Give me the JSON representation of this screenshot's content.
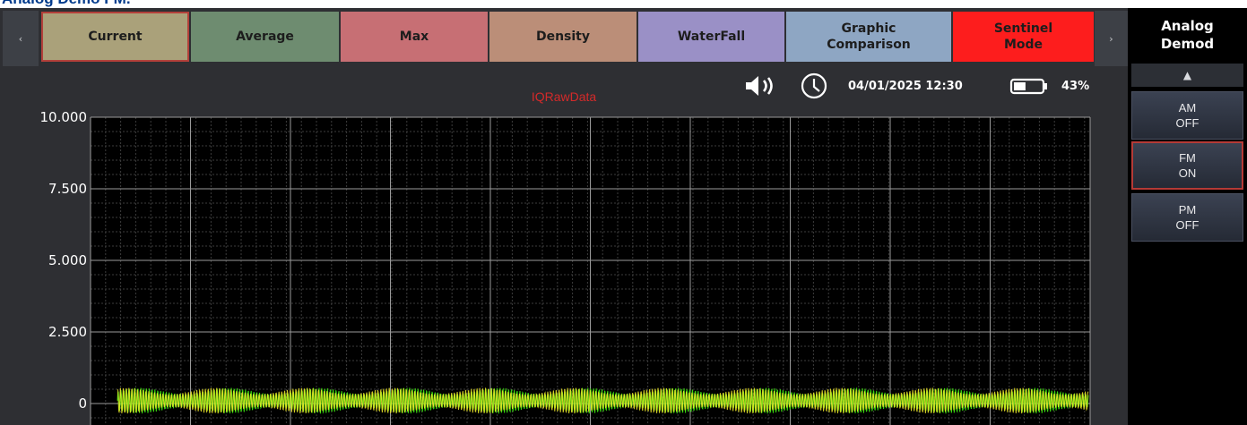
{
  "page_heading": "Analog Demo FM.",
  "tabs": [
    {
      "label": "Current",
      "bg": "#aaa17a",
      "active": true
    },
    {
      "label": "Average",
      "bg": "#6e8c70",
      "active": false
    },
    {
      "label": "Max",
      "bg": "#c76f74",
      "active": false
    },
    {
      "label": "Density",
      "bg": "#bb8e78",
      "active": false
    },
    {
      "label": "WaterFall",
      "bg": "#9a90c6",
      "active": false
    },
    {
      "label": "Graphic Comparison",
      "bg": "#8ea6c3",
      "active": false
    },
    {
      "label": "Sentinel Mode",
      "bg": "#fd1d1d",
      "active": false
    }
  ],
  "scroll_left_icon": "chevron-left-icon",
  "scroll_right_icon": "chevron-right-icon",
  "scroll_left_glyph": "‹",
  "scroll_right_glyph": "›",
  "side_panel": {
    "title": "Analog Demod",
    "up_icon": "triangle-up-icon",
    "up_glyph": "▲",
    "buttons": [
      {
        "mode": "AM",
        "state": "OFF",
        "active": false
      },
      {
        "mode": "FM",
        "state": "ON",
        "active": true
      },
      {
        "mode": "PM",
        "state": "OFF",
        "active": false
      }
    ]
  },
  "status": {
    "speaker_icon": "speaker-icon",
    "clock_icon": "clock-icon",
    "datetime": "04/01/2025 12:30",
    "battery_icon": "battery-icon",
    "battery_percent": "43%",
    "battery_level": 0.43
  },
  "colors": {
    "title_red": "#d42a2a",
    "trace_green": "#39d70e",
    "trace_yellow": "#f3ef2a",
    "plot_bg": "#000000",
    "active_border": "#b3403a"
  },
  "chart_data": {
    "type": "line",
    "title": "IQRawData",
    "xlabel": "",
    "ylabel": "",
    "ylim": [
      0,
      10
    ],
    "yticks": [
      "0",
      "2.500",
      "5.000",
      "7.500",
      "10.000"
    ],
    "grid": true,
    "series": [
      {
        "color": "#39d70e",
        "description_level": "oscillation roughly between -0.3 and 0.6",
        "center": 0.1,
        "amplitude": 0.45
      },
      {
        "color": "#f3ef2a",
        "center": 0.1,
        "amplitude": 0.45
      }
    ]
  }
}
